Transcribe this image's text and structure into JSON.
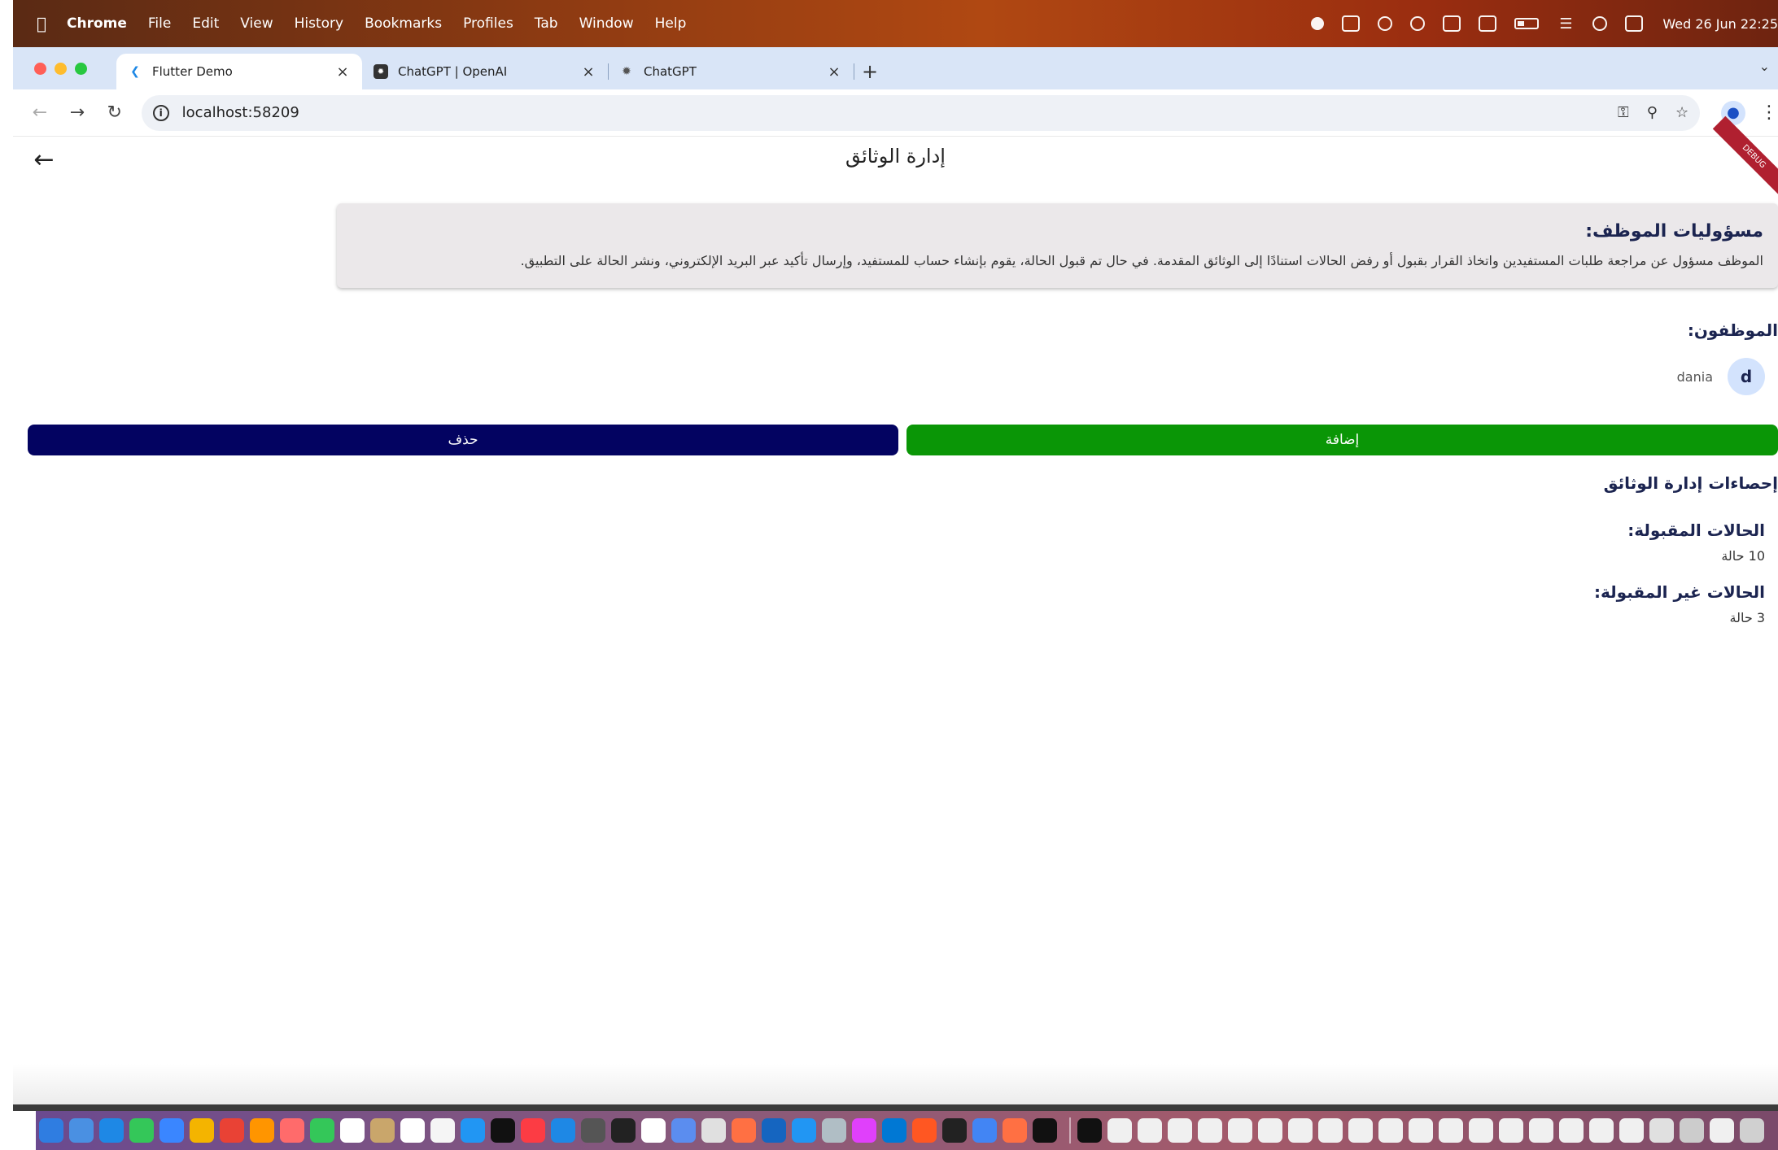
{
  "menubar": {
    "app_name": "Chrome",
    "items": [
      "File",
      "Edit",
      "View",
      "History",
      "Bookmarks",
      "Profiles",
      "Tab",
      "Window",
      "Help"
    ],
    "clock": "Wed 26 Jun  22:25"
  },
  "tabs": [
    {
      "title": "Flutter Demo",
      "active": true
    },
    {
      "title": "ChatGPT | OpenAI",
      "active": false
    },
    {
      "title": "ChatGPT",
      "active": false
    }
  ],
  "toolbar": {
    "url": "localhost:58209"
  },
  "app": {
    "title": "إدارة الوثائق",
    "debug_banner": "DEBUG",
    "responsibilities": {
      "title": "مسؤوليات الموظف:",
      "text": "الموظف مسؤول عن مراجعة طلبات المستفيدين واتخاذ القرار بقبول أو رفض الحالات استنادًا إلى الوثائق المقدمة. في حال تم قبول الحالة، يقوم بإنشاء حساب للمستفيد، وإرسال تأكيد عبر البريد الإلكتروني، ونشر الحالة على التطبيق."
    },
    "employees": {
      "label": "الموظفون:",
      "list": [
        {
          "initial": "d",
          "name": "dania"
        }
      ]
    },
    "buttons": {
      "add": "إضافة",
      "delete": "حذف"
    },
    "stats": {
      "title": "إحصاءات إدارة الوثائق",
      "accepted_label": "الحالات المقبولة:",
      "accepted_value": "10 حالة",
      "rejected_label": "الحالات غير المقبولة:",
      "rejected_value": "3 حالة"
    }
  },
  "colors": {
    "add_button": "#0a9606",
    "delete_button": "#030361",
    "card_bg": "#ebe8ea",
    "heading": "#1b2450"
  },
  "dock_colors": [
    "#2f7de1",
    "#4a90e2",
    "#1e88e5",
    "#34c759",
    "#3a86ff",
    "#f4b400",
    "#e94235",
    "#ff9500",
    "#ff6b6b",
    "#34c759",
    "#ffffff",
    "#c9a66b",
    "#ffffff",
    "#f5f5f5",
    "#2196f3",
    "#111111",
    "#fc3c44",
    "#1e88e5",
    "#555555",
    "#222222",
    "#ffffff",
    "#5b8def",
    "#e0e0e0",
    "#ff7043",
    "#1565c0",
    "#2196f3",
    "#b0bec5",
    "#e040fb",
    "#0078d4",
    "#ff5722",
    "#222222",
    "#4285f4",
    "#ff7043",
    "#111111",
    "#111111",
    "#f0f0f0",
    "#f0f0f0",
    "#f0f0f0",
    "#f0f0f0",
    "#f0f0f0",
    "#f0f0f0",
    "#f0f0f0",
    "#f0f0f0",
    "#f0f0f0",
    "#f0f0f0",
    "#f0f0f0",
    "#f0f0f0",
    "#f0f0f0",
    "#f0f0f0",
    "#f0f0f0",
    "#f0f0f0",
    "#f0f0f0",
    "#f0f0f0",
    "#e0e0e0",
    "#cccccc",
    "#f0f0f0",
    "#d0d0d0"
  ]
}
